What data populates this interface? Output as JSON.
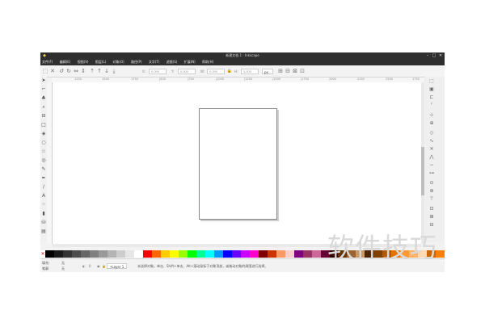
{
  "window": {
    "title": "新建文档 1 - Inkscape",
    "controls": [
      "–",
      "□",
      "✕"
    ]
  },
  "menu": [
    "文件(F)",
    "编辑(E)",
    "视图(V)",
    "图层(L)",
    "对象(O)",
    "路径(P)",
    "文字(T)",
    "滤镜(S)",
    "扩展(N)",
    "帮助(H)"
  ],
  "toolbar": {
    "x_label": "X:",
    "x_value": "0.000",
    "y_label": "Y:",
    "y_value": "0.000",
    "w_label": "W:",
    "w_value": "0.000",
    "h_label": "H:",
    "h_value": "0.000",
    "unit": "px"
  },
  "ruler_ticks": [
    "1250",
    "1500",
    "1750",
    "|500",
    "|750",
    "|1000",
    "|1250",
    "|1500",
    "|1750",
    "2000",
    "2250",
    "2500",
    "1750"
  ],
  "status": {
    "fill_label": "填充:",
    "fill_value": "无",
    "stroke_label": "笔廓:",
    "stroke_value": "无",
    "opacity": "0",
    "layer": "•Layer 1",
    "message": "未选择对象。单击、Shift+单击、Alt+滚动鼠标于对象顶部，或拖动对象的周围进行选择。"
  },
  "palette_colors": [
    "#000000",
    "#1a1a1a",
    "#333333",
    "#4d4d4d",
    "#666666",
    "#808080",
    "#999999",
    "#b3b3b3",
    "#cccccc",
    "#e6e6e6",
    "#ffffff",
    "#ff0000",
    "#ff6600",
    "#ffcc00",
    "#ffff00",
    "#99ff00",
    "#00ff00",
    "#00ff99",
    "#00ffff",
    "#0099ff",
    "#0000ff",
    "#6600ff",
    "#cc00ff",
    "#ff00cc",
    "#800000",
    "#cc3300",
    "#ff9966",
    "#ffcccc",
    "#800080",
    "#993366",
    "#cc6699",
    "#660033",
    "#330000",
    "#663300",
    "#996633",
    "#cc9966",
    "#4d2600",
    "#804000",
    "#b35900",
    "#e67300",
    "#ff9933",
    "#ffb366",
    "#ffd9b3",
    "#cc6600",
    "#ff8000"
  ],
  "watermark": "软件技巧"
}
